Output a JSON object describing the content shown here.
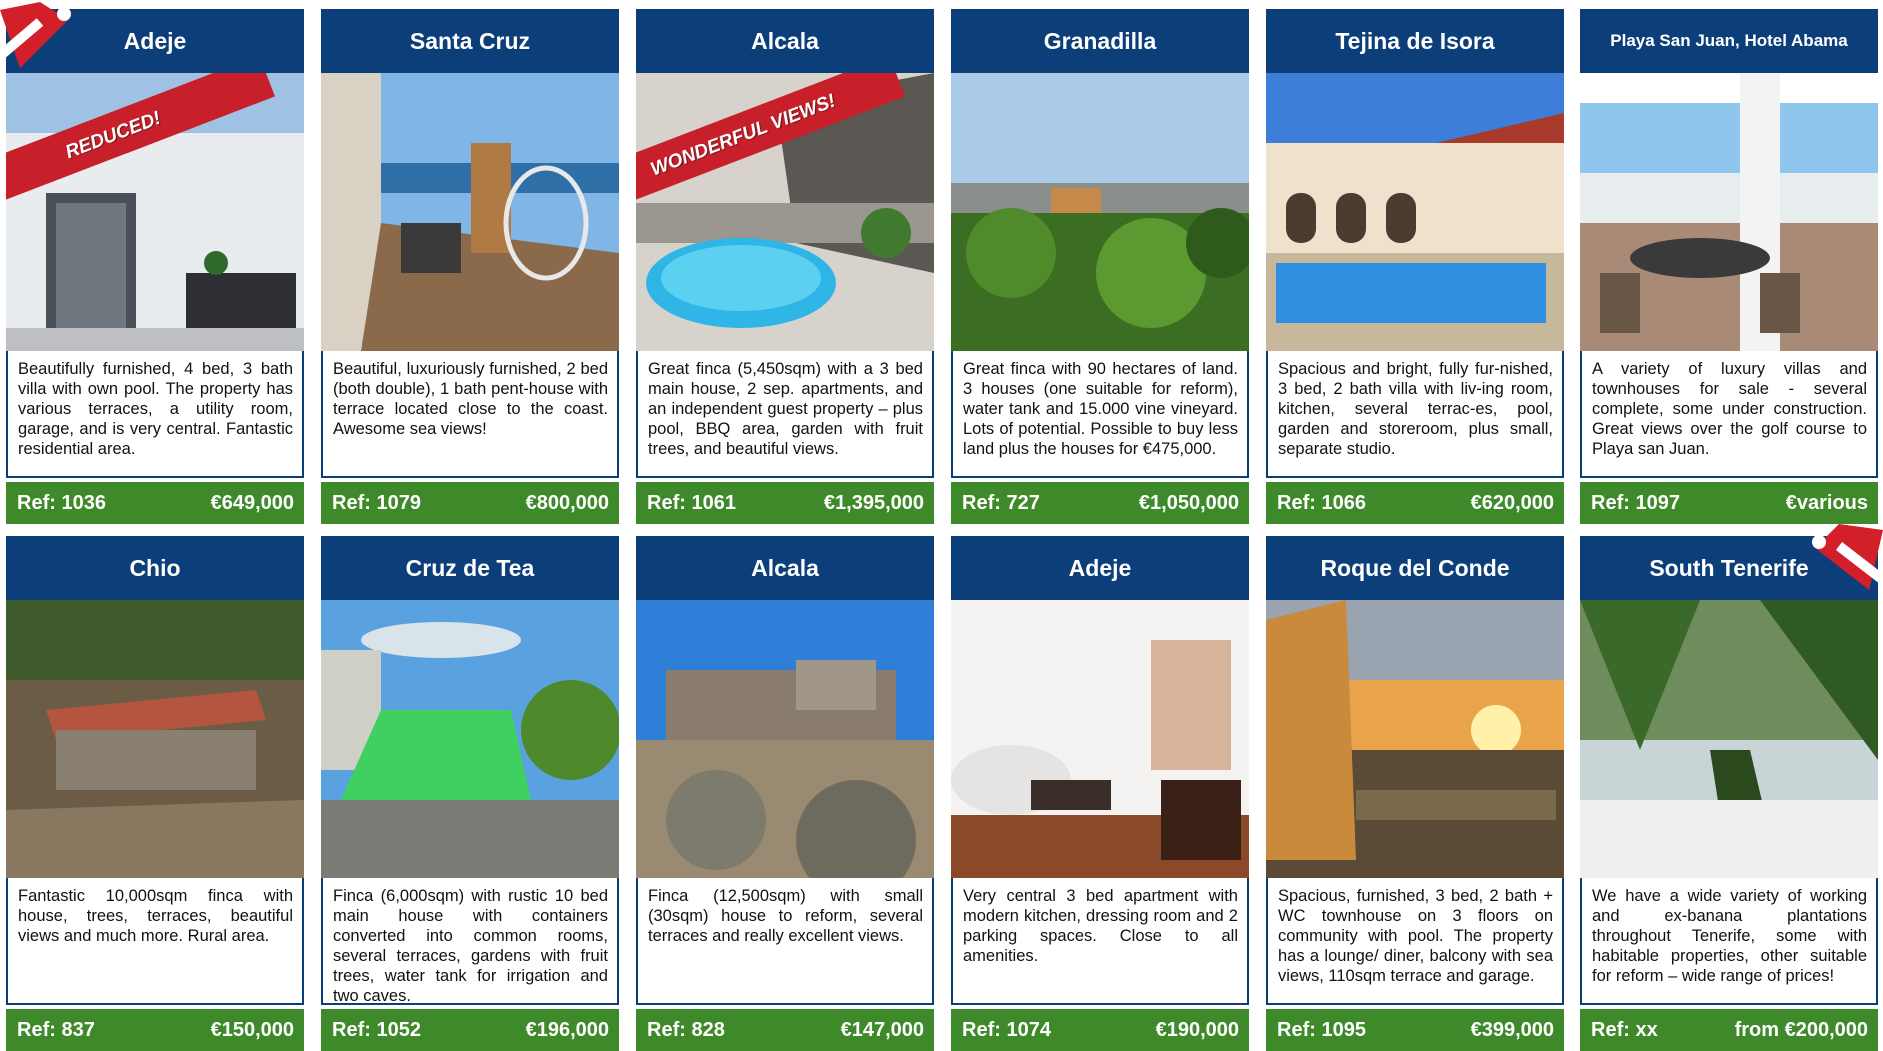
{
  "listings": [
    {
      "location": "Adeje",
      "badge": "REDUCED!",
      "description": "Beautifully furnished, 4 bed, 3 bath villa with own pool. The property has various terraces, a utility room, garage, and is very central. Fantastic residential area.",
      "ref": "Ref: 1036",
      "price": "€649,000"
    },
    {
      "location": "Santa Cruz",
      "badge": "",
      "description": "Beautiful, luxuriously furnished, 2 bed (both double), 1 bath pent-house with terrace located close to the coast. Awesome sea views!",
      "ref": "Ref: 1079",
      "price": "€800,000"
    },
    {
      "location": "Alcala",
      "badge": "WONDERFUL VIEWS!",
      "description": "Great finca (5,450sqm) with a 3 bed main house, 2 sep. apartments, and an independent guest property – plus pool, BBQ area, garden with fruit trees, and beautiful views.",
      "ref": "Ref: 1061",
      "price": "€1,395,000"
    },
    {
      "location": "Granadilla",
      "badge": "",
      "description": "Great finca with 90 hectares of land. 3 houses (one suitable for reform), water tank and 15.000 vine vineyard. Lots of potential. Possible to buy less land plus the houses for €475,000.",
      "ref": "Ref: 727",
      "price": "€1,050,000"
    },
    {
      "location": "Tejina de Isora",
      "badge": "",
      "description": "Spacious and bright, fully fur-nished, 3 bed, 2 bath villa with liv-ing room, kitchen, several terrac-es, pool, garden and storeroom, plus small, separate studio.",
      "ref": "Ref: 1066",
      "price": "€620,000"
    },
    {
      "location": "Playa San Juan, Hotel Abama",
      "badge": "",
      "description": "A variety of luxury villas and townhouses for sale - several complete, some under construction. Great views over the golf course to Playa san Juan.",
      "ref": "Ref: 1097",
      "price": "€various"
    },
    {
      "location": "Chio",
      "badge": "",
      "description": "Fantastic 10,000sqm finca with house, trees, terraces, beautiful views and much more. Rural area.",
      "ref": "Ref: 837",
      "price": "€150,000"
    },
    {
      "location": "Cruz de Tea",
      "badge": "",
      "description": "Finca (6,000sqm) with rustic 10 bed main house with containers converted into common rooms, several terraces, gardens with fruit trees, water tank for irrigation and two caves.",
      "ref": "Ref: 1052",
      "price": "€196,000"
    },
    {
      "location": "Alcala",
      "badge": "",
      "description": "Finca (12,500sqm) with small (30sqm) house to reform, several terraces and really excellent views.",
      "ref": "Ref: 828",
      "price": "€147,000"
    },
    {
      "location": "Adeje",
      "badge": "",
      "description": "Very central 3 bed apartment with modern kitchen, dressing room and 2 parking spaces. Close to all amenities.",
      "ref": "Ref: 1074",
      "price": "€190,000"
    },
    {
      "location": "Roque del Conde",
      "badge": "",
      "description": "Spacious, furnished, 3 bed, 2 bath + WC townhouse on 3 floors on community with pool. The property has a lounge/ diner, balcony with sea views, 110sqm terrace and garage.",
      "ref": "Ref: 1095",
      "price": "€399,000"
    },
    {
      "location": "South Tenerife",
      "badge": "",
      "description": "We have a wide variety of working and ex-banana plantations throughout Tenerife, some with habitable properties, other suitable for reform – wide range of prices!",
      "ref": "Ref: xx",
      "price": "from €200,000"
    }
  ],
  "colors": {
    "header": "#0c3f7a",
    "footer": "#3e8a2a",
    "badge": "#c8202a"
  }
}
